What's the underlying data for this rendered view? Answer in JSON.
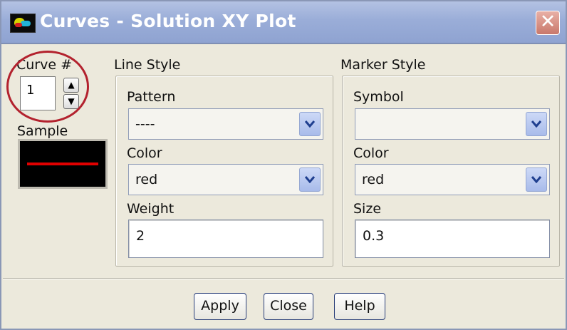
{
  "window": {
    "title": "Curves - Solution XY Plot",
    "close_glyph": "✕"
  },
  "curve": {
    "label": "Curve #",
    "value": "1",
    "up_glyph": "▲",
    "down_glyph": "▼"
  },
  "sample": {
    "label": "Sample",
    "line_color": "#e00000"
  },
  "line_style": {
    "title": "Line Style",
    "pattern_label": "Pattern",
    "pattern_value": "----",
    "color_label": "Color",
    "color_value": "red",
    "weight_label": "Weight",
    "weight_value": "2"
  },
  "marker_style": {
    "title": "Marker Style",
    "symbol_label": "Symbol",
    "symbol_value": "",
    "color_label": "Color",
    "color_value": "red",
    "size_label": "Size",
    "size_value": "0.3"
  },
  "buttons": {
    "apply": "Apply",
    "close": "Close",
    "help": "Help"
  },
  "colors": {
    "titlebar": "#9aadd8",
    "dialog_bg": "#ece9dc",
    "annotation_circle": "#b3222e",
    "sample_bg": "#000000"
  }
}
